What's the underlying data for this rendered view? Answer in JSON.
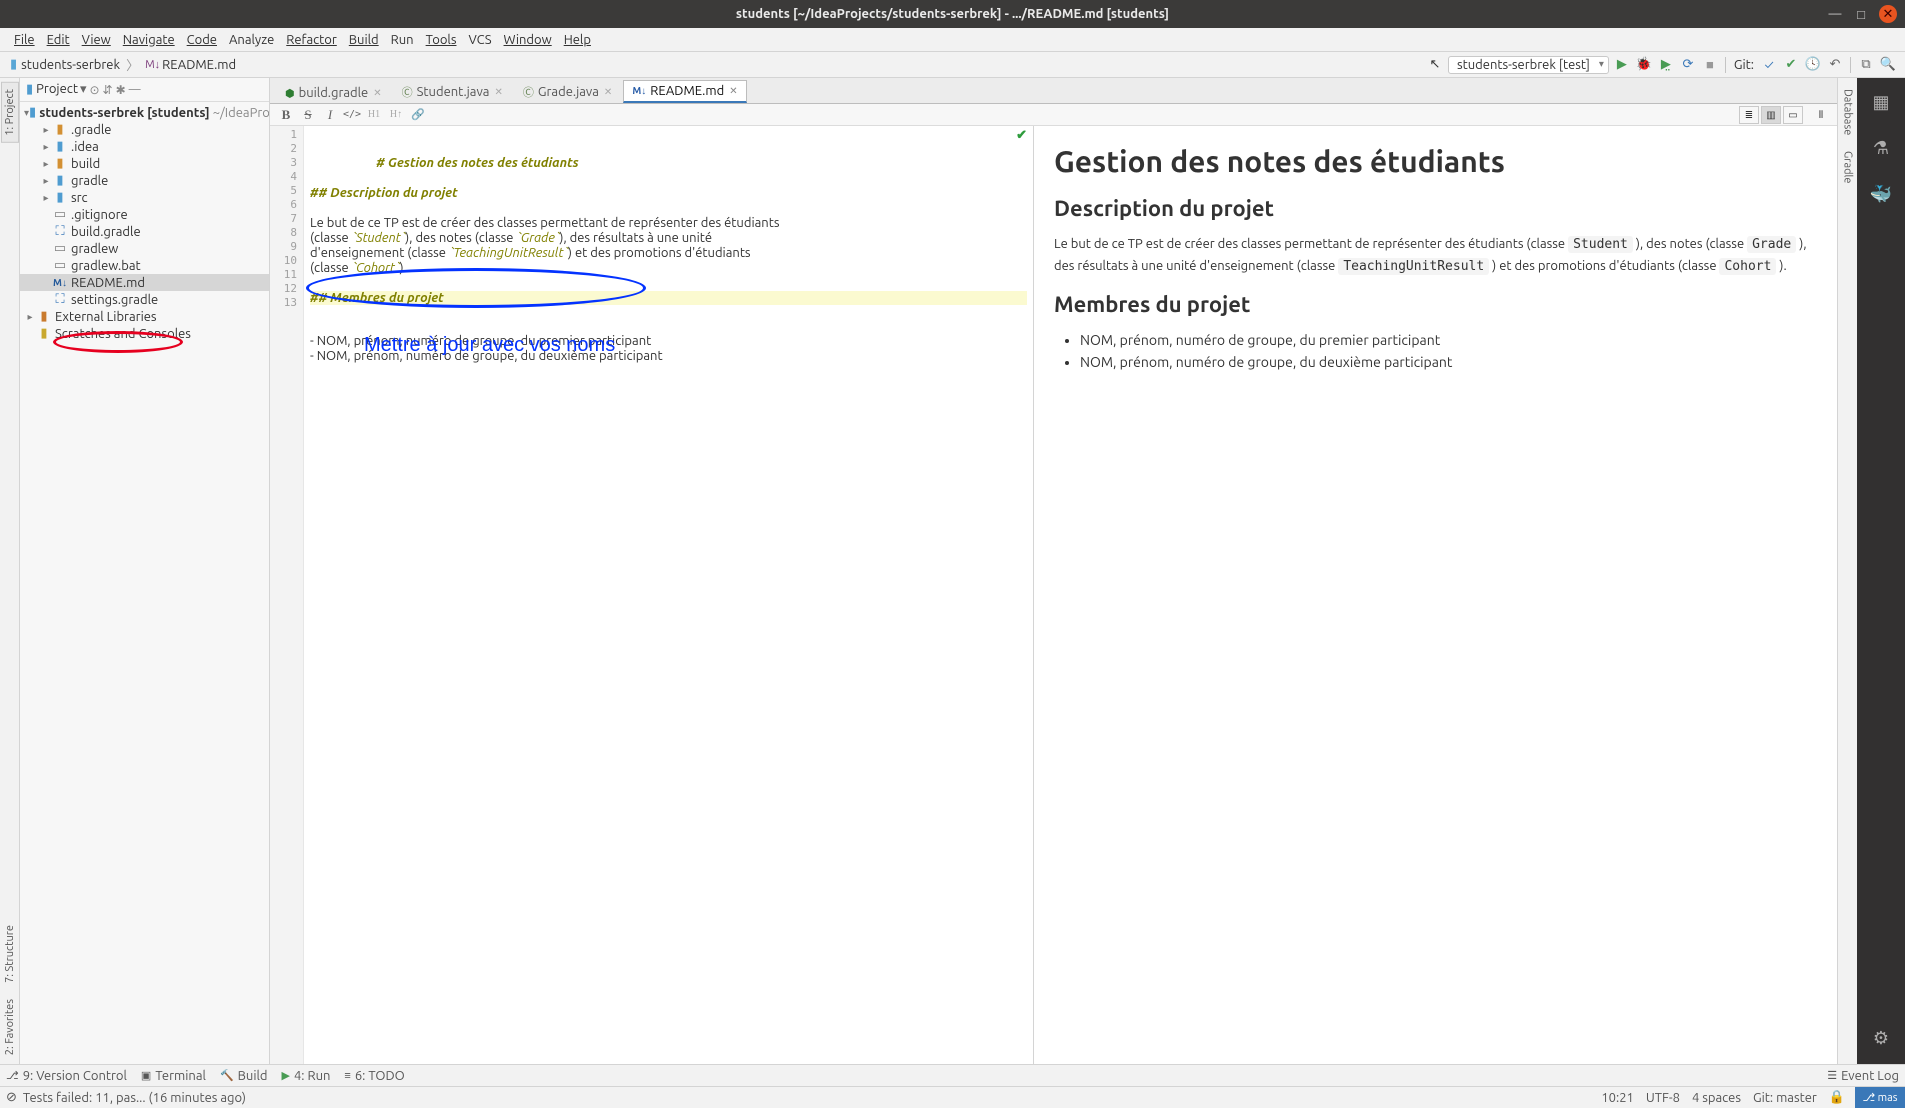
{
  "titlebar": {
    "title": "students [~/IdeaProjects/students-serbrek] - .../README.md [students]"
  },
  "menubar": [
    "File",
    "Edit",
    "View",
    "Navigate",
    "Code",
    "Analyze",
    "Refactor",
    "Build",
    "Run",
    "Tools",
    "VCS",
    "Window",
    "Help"
  ],
  "breadcrumb": {
    "root": "students-serbrek",
    "file": "README.md"
  },
  "run_config": {
    "label": "students-serbrek [test]"
  },
  "git_label": "Git:",
  "left_gutter": {
    "project_tab": "1: Project",
    "structure_tab": "7: Structure",
    "favorites_tab": "2: Favorites"
  },
  "right_gutter": {
    "database_tab": "Database",
    "gradle_tab": "Gradle"
  },
  "project_panel": {
    "header_label": "Project",
    "tree": {
      "root_name": "students-serbrek",
      "root_module": "[students]",
      "root_path": "~/IdeaProjects",
      "items": [
        {
          "name": ".gradle",
          "type": "folder-orange",
          "depth": 1,
          "expandable": true
        },
        {
          "name": ".idea",
          "type": "folder-blue",
          "depth": 1,
          "expandable": true
        },
        {
          "name": "build",
          "type": "folder-orange",
          "depth": 1,
          "expandable": true
        },
        {
          "name": "gradle",
          "type": "folder-blue",
          "depth": 1,
          "expandable": true
        },
        {
          "name": "src",
          "type": "folder-blue",
          "depth": 1,
          "expandable": true
        },
        {
          "name": ".gitignore",
          "type": "file-grey",
          "depth": 1
        },
        {
          "name": "build.gradle",
          "type": "file-gradle",
          "depth": 1
        },
        {
          "name": "gradlew",
          "type": "file-grey",
          "depth": 1
        },
        {
          "name": "gradlew.bat",
          "type": "file-grey",
          "depth": 1
        },
        {
          "name": "README.md",
          "type": "file-md",
          "depth": 1,
          "selected": true
        },
        {
          "name": "settings.gradle",
          "type": "file-gradle",
          "depth": 1
        }
      ],
      "external_libs": "External Libraries",
      "scratches": "Scratches and Consoles"
    }
  },
  "editor_tabs": [
    {
      "label": "build.gradle",
      "icon": "gradle"
    },
    {
      "label": "Student.java",
      "icon": "java"
    },
    {
      "label": "Grade.java",
      "icon": "java"
    },
    {
      "label": "README.md",
      "icon": "md",
      "active": true
    }
  ],
  "md_toolbar": {
    "bold": "B",
    "strike": "S",
    "italic": "I",
    "code": "</>",
    "h1": "H1",
    "h_up": "H↑",
    "link": "🔗"
  },
  "editor_lines": [
    "# Gestion des notes des étudiants",
    "",
    "## Description du projet",
    "",
    "Le but de ce TP est de créer des classes permettant de représenter des étudiants ",
    "(classe `Student`), des notes (classe `Grade`), des résultats à une unité ",
    "d'enseignement (classe `TeachingUnitResult`) et des promotions d'étudiants ",
    "(classe `Cohort`).",
    "",
    "## Membres du projet",
    "",
    "- NOM, prénom, numéro de groupe, du premier participant",
    "- NOM, prénom, numéro de groupe, du deuxième participant"
  ],
  "annotation_text": "Mettre à jour avec vos noms",
  "preview": {
    "h1": "Gestion des notes des étudiants",
    "h2a": "Description du projet",
    "p_part1": "Le but de ce TP est de créer des classes permettant de représenter des étudiants (classe ",
    "code1": "Student",
    "p_part2": " ), des notes (classe ",
    "code2": "Grade",
    "p_part3": " ), des résultats à une unité d'enseignement (classe ",
    "code3": "TeachingUnitResult",
    "p_part4": " ) et des promotions d'étudiants (classe ",
    "code4": "Cohort",
    "p_part5": " ).",
    "h2b": "Membres du projet",
    "li1": "NOM, prénom, numéro de groupe, du premier participant",
    "li2": "NOM, prénom, numéro de groupe, du deuxième participant"
  },
  "bottom_tabs": {
    "vcs": "9: Version Control",
    "terminal": "Terminal",
    "build": "Build",
    "run": "4: Run",
    "todo": "6: TODO",
    "event_log": "Event Log"
  },
  "statusbar": {
    "left_icon": "⊘",
    "message": "Tests failed: 11, pas... (16 minutes ago)",
    "cursor": "10:21",
    "encoding": "UTF-8",
    "indent": "4 spaces",
    "branch": "Git: master",
    "badge": "⎇ mas"
  }
}
